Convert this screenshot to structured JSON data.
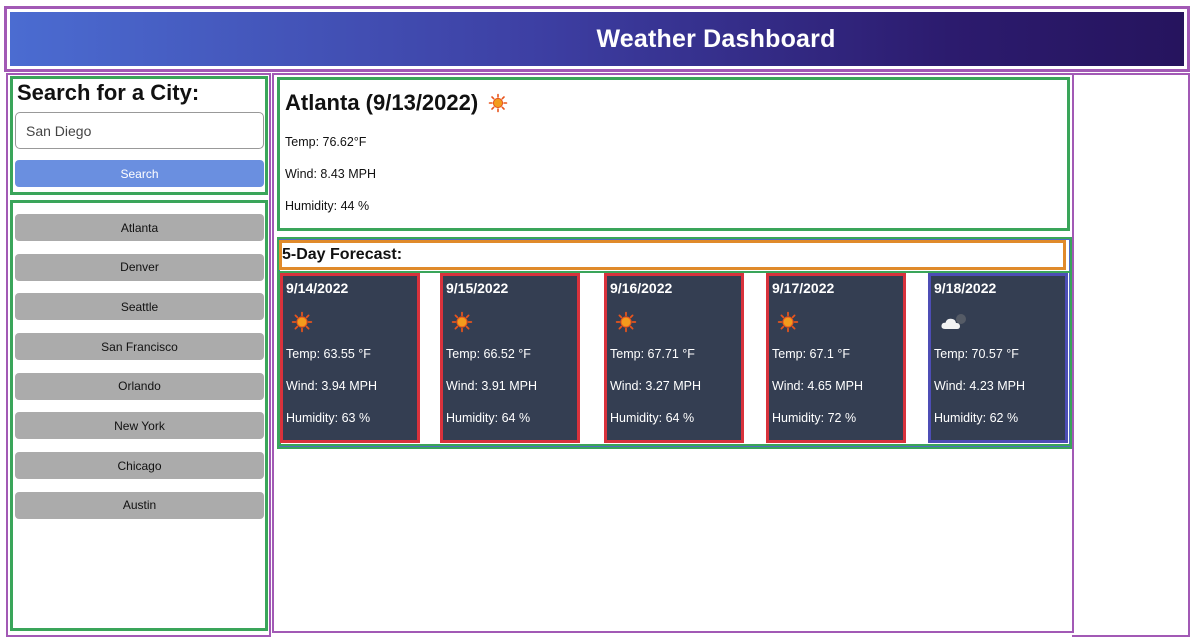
{
  "header": {
    "title": "Weather Dashboard"
  },
  "search": {
    "title": "Search for a City:",
    "value": "San Diego",
    "button_label": "Search"
  },
  "history": {
    "items": [
      {
        "label": "Atlanta"
      },
      {
        "label": "Denver"
      },
      {
        "label": "Seattle"
      },
      {
        "label": "San Francisco"
      },
      {
        "label": "Orlando"
      },
      {
        "label": "New York"
      },
      {
        "label": "Chicago"
      },
      {
        "label": "Austin"
      }
    ]
  },
  "current": {
    "title": "Atlanta (9/13/2022)",
    "icon": "sun-icon",
    "temp": "Temp: 76.62°F",
    "wind": "Wind: 8.43 MPH",
    "humidity": "Humidity: 44 %"
  },
  "forecast": {
    "title": "5-Day Forecast:",
    "days": [
      {
        "date": "9/14/2022",
        "icon": "sun-icon",
        "temp": "Temp: 63.55 °F",
        "wind": "Wind: 3.94 MPH",
        "humidity": "Humidity: 63 %"
      },
      {
        "date": "9/15/2022",
        "icon": "sun-icon",
        "temp": "Temp: 66.52 °F",
        "wind": "Wind: 3.91 MPH",
        "humidity": "Humidity: 64 %"
      },
      {
        "date": "9/16/2022",
        "icon": "sun-icon",
        "temp": "Temp: 67.71 °F",
        "wind": "Wind: 3.27 MPH",
        "humidity": "Humidity: 64 %"
      },
      {
        "date": "9/17/2022",
        "icon": "sun-icon",
        "temp": "Temp: 67.1 °F",
        "wind": "Wind: 4.65 MPH",
        "humidity": "Humidity: 72 %"
      },
      {
        "date": "9/18/2022",
        "icon": "cloud-icon",
        "temp": "Temp: 70.57 °F",
        "wind": "Wind: 4.23 MPH",
        "humidity": "Humidity: 62 %"
      }
    ]
  },
  "colors": {
    "header_start": "#4b6cd1",
    "header_end": "#26145e",
    "search_button": "#6a8fe0",
    "history_button": "#ababab",
    "card_bg": "#343e52"
  }
}
